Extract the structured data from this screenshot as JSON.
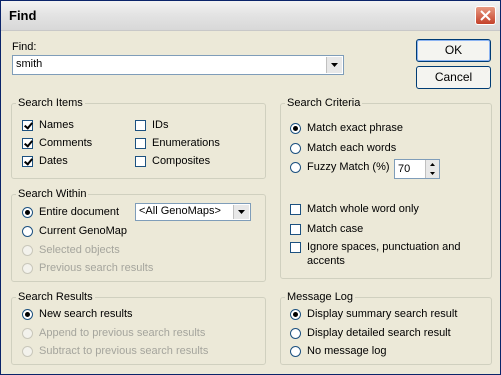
{
  "window": {
    "title": "Find"
  },
  "find": {
    "label": "Find:",
    "value": "smith"
  },
  "buttons": {
    "ok": "OK",
    "cancel": "Cancel"
  },
  "search_items": {
    "title": "Search Items",
    "items": [
      {
        "label": "Names",
        "checked": true
      },
      {
        "label": "Comments",
        "checked": true
      },
      {
        "label": "Dates",
        "checked": true
      },
      {
        "label": "IDs",
        "checked": false
      },
      {
        "label": "Enumerations",
        "checked": false
      },
      {
        "label": "Composites",
        "checked": false
      }
    ]
  },
  "search_within": {
    "title": "Search Within",
    "options": [
      {
        "label": "Entire document",
        "selected": true,
        "enabled": true
      },
      {
        "label": "Current GenoMap",
        "selected": false,
        "enabled": true
      },
      {
        "label": "Selected objects",
        "selected": false,
        "enabled": false
      },
      {
        "label": "Previous search results",
        "selected": false,
        "enabled": false
      }
    ],
    "map_select": "<All GenoMaps>"
  },
  "search_results": {
    "title": "Search Results",
    "options": [
      {
        "label": "New search results",
        "selected": true,
        "enabled": true
      },
      {
        "label": "Append to previous search results",
        "selected": false,
        "enabled": false
      },
      {
        "label": "Subtract to previous search results",
        "selected": false,
        "enabled": false
      }
    ]
  },
  "search_criteria": {
    "title": "Search Criteria",
    "options": [
      {
        "label": "Match exact phrase",
        "selected": true
      },
      {
        "label": "Match each words",
        "selected": false
      },
      {
        "label": "Fuzzy Match (%)",
        "selected": false
      }
    ],
    "fuzzy_value": "70",
    "checks": [
      {
        "label": "Match whole word only",
        "checked": false
      },
      {
        "label": "Match case",
        "checked": false
      },
      {
        "label": "Ignore spaces, punctuation and",
        "checked": false
      },
      {
        "label": "accents"
      }
    ]
  },
  "message_log": {
    "title": "Message Log",
    "options": [
      {
        "label": "Display summary search result",
        "selected": true
      },
      {
        "label": "Display detailed search result",
        "selected": false
      },
      {
        "label": "No message log",
        "selected": false
      }
    ]
  }
}
